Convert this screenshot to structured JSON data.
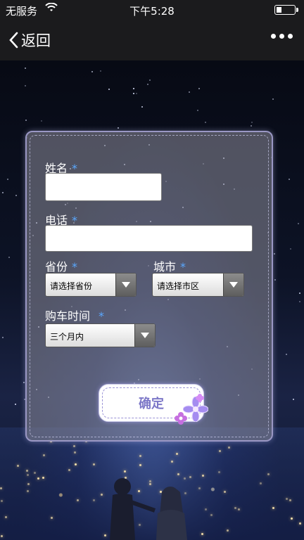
{
  "status_bar": {
    "carrier": "无服务",
    "time": "下午5:28",
    "battery_level": 0.3,
    "wifi_icon": "wifi-icon",
    "battery_icon": "battery-icon"
  },
  "nav": {
    "back_label": "返回",
    "back_icon": "chevron-left-icon",
    "more_icon": "more-icon"
  },
  "form": {
    "name_label": "姓名",
    "phone_label": "电话",
    "province_label": "省份",
    "city_label": "城市",
    "time_label": "购车时间",
    "required_mark": "*",
    "name_value": "",
    "phone_value": "",
    "province_select": "请选择省份",
    "city_select": "请选择市区",
    "time_select": "三个月内",
    "submit_label": "确定"
  },
  "colors": {
    "required": "#5aa8ff",
    "button_text": "#7d78c8",
    "card_border": "#9a97c4"
  }
}
